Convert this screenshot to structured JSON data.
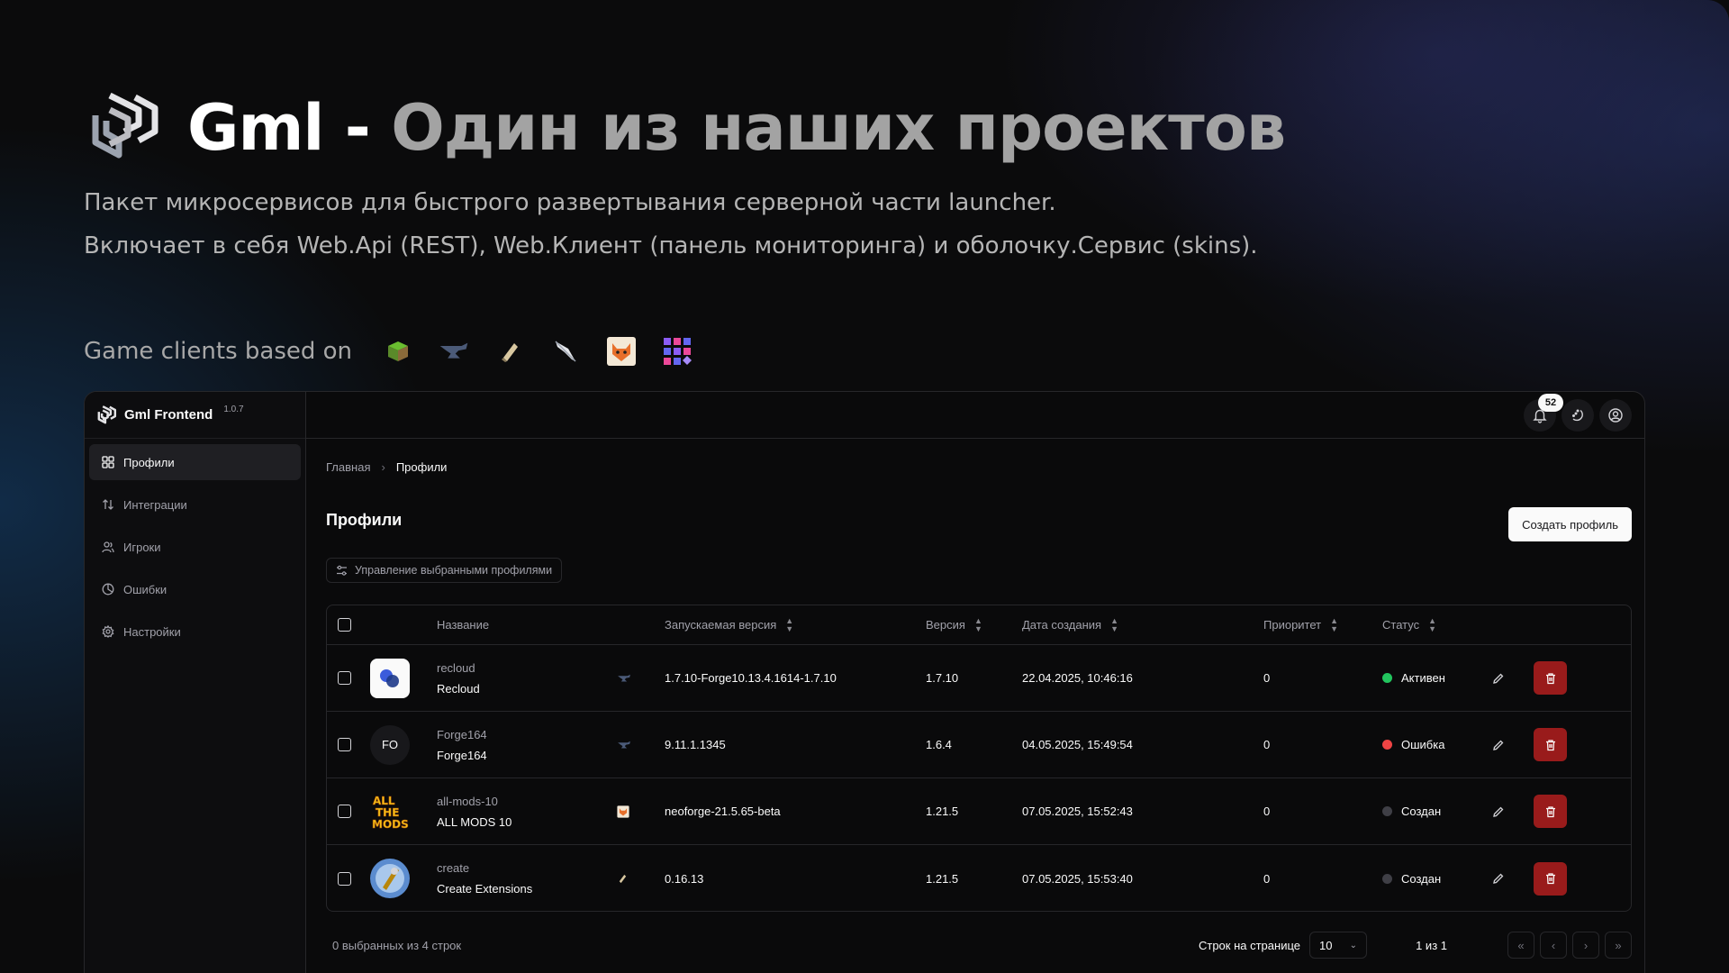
{
  "hero": {
    "title_strong": "Gml -",
    "title_muted": "Один из наших проектов",
    "line1": "Пакет микросервисов для быстрого развертывания серверной части launcher.",
    "line2": "Включает в себя Web.Api (REST), Web.Клиент (панель мониторинга) и оболочку.Сервис (skins).",
    "clients_label": "Game clients based on",
    "client_icons": [
      "minecraft-grass-block-icon",
      "forge-anvil-icon",
      "fabric-icon",
      "quilt-feather-icon",
      "neoforge-fox-icon",
      "liteloader-grid-icon"
    ]
  },
  "app": {
    "brand": "Gml Frontend",
    "version": "1.0.7",
    "notifications_count": "52",
    "nav": [
      {
        "label": "Профили",
        "icon": "profiles-icon",
        "active": true
      },
      {
        "label": "Интеграции",
        "icon": "integrations-icon",
        "active": false
      },
      {
        "label": "Игроки",
        "icon": "players-icon",
        "active": false
      },
      {
        "label": "Ошибки",
        "icon": "errors-icon",
        "active": false
      },
      {
        "label": "Настройки",
        "icon": "settings-icon",
        "active": false
      }
    ],
    "breadcrumb": [
      "Главная",
      "Профили"
    ],
    "page_title": "Профили",
    "create_button": "Создать профиль",
    "manage_button": "Управление выбранными профилями",
    "table": {
      "columns": [
        "Название",
        "Запускаемая версия",
        "Версия",
        "Дата создания",
        "Приоритет",
        "Статус"
      ],
      "rows": [
        {
          "slug": "recloud",
          "name": "Recloud",
          "loader": "forge",
          "launch_version": "1.7.10-Forge10.13.4.1614-1.7.10",
          "version": "1.7.10",
          "created": "22.04.2025, 10:46:16",
          "priority": "0",
          "status": "Активен",
          "status_color": "#22c55e",
          "avatar": "recloud"
        },
        {
          "slug": "Forge164",
          "name": "Forge164",
          "loader": "forge",
          "launch_version": "9.11.1.1345",
          "version": "1.6.4",
          "created": "04.05.2025, 15:49:54",
          "priority": "0",
          "status": "Ошибка",
          "status_color": "#ef4444",
          "avatar": "FO"
        },
        {
          "slug": "all-mods-10",
          "name": "ALL MODS 10",
          "loader": "neoforge",
          "launch_version": "neoforge-21.5.65-beta",
          "version": "1.21.5",
          "created": "07.05.2025, 15:52:43",
          "priority": "0",
          "status": "Создан",
          "status_color": "#3f3f46",
          "avatar": "ATM"
        },
        {
          "slug": "create",
          "name": "Create Extensions",
          "loader": "fabric",
          "launch_version": "0.16.13",
          "version": "1.21.5",
          "created": "07.05.2025, 15:53:40",
          "priority": "0",
          "status": "Создан",
          "status_color": "#3f3f46",
          "avatar": "create"
        }
      ]
    },
    "footer": {
      "selected_text": "0 выбранных из 4 строк",
      "rows_per_page_label": "Строк на странице",
      "rows_per_page_value": "10",
      "page_indicator": "1 из 1"
    }
  }
}
